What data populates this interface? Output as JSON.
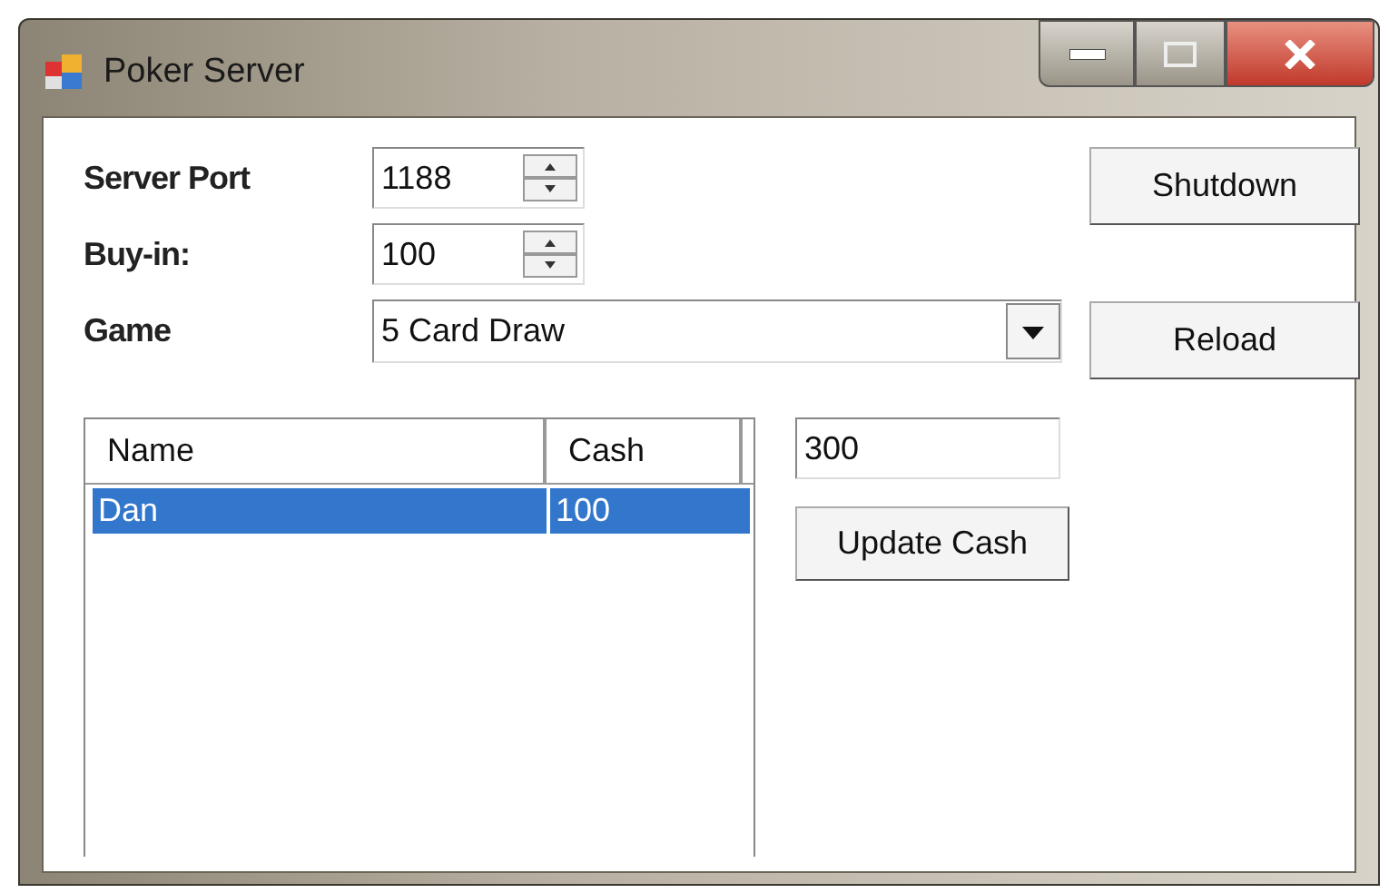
{
  "window": {
    "title": "Poker Server"
  },
  "fields": [
    {
      "label": "Server Port",
      "value": "1188",
      "kind": "spinner"
    },
    {
      "label": "Buy-in:",
      "value": "100",
      "kind": "spinner"
    },
    {
      "label": "Game",
      "value": "5 Card Draw",
      "kind": "dropdown"
    }
  ],
  "buttons": [
    "Shutdown",
    "Reload"
  ],
  "players": {
    "columns": [
      "Name",
      "Cash"
    ],
    "rows": [
      {
        "cells": [
          "Dan",
          "100"
        ],
        "selected": true
      }
    ]
  },
  "cash_field": {
    "value": "300"
  },
  "update_button": "Update Cash"
}
